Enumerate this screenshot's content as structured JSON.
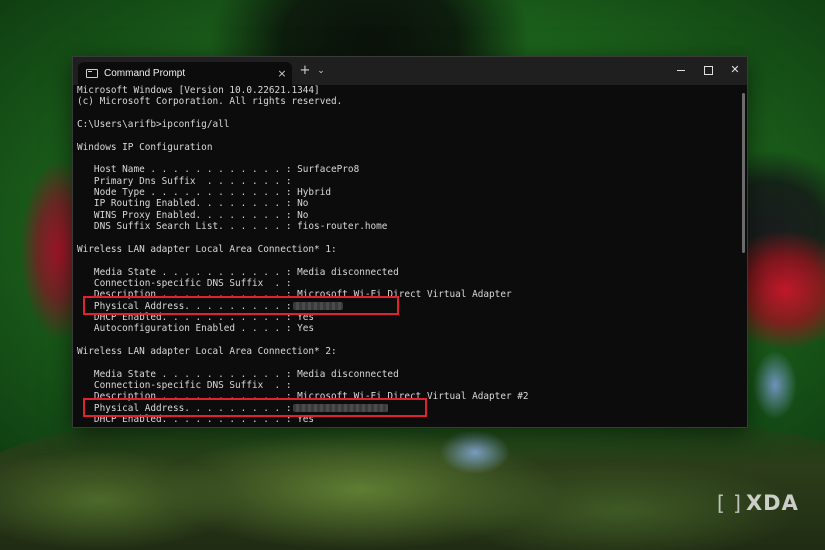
{
  "window": {
    "tab_title": "Command Prompt",
    "tab_close_icon": "×",
    "new_tab_icon": "+",
    "dropdown_icon": "⌄",
    "close_icon": "✕"
  },
  "console": {
    "lines": [
      "Microsoft Windows [Version 10.0.22621.1344]",
      "(c) Microsoft Corporation. All rights reserved.",
      "",
      "C:\\Users\\arifb>ipconfig/all",
      "",
      "Windows IP Configuration",
      "",
      "   Host Name . . . . . . . . . . . . : SurfacePro8",
      "   Primary Dns Suffix  . . . . . . . :",
      "   Node Type . . . . . . . . . . . . : Hybrid",
      "   IP Routing Enabled. . . . . . . . : No",
      "   WINS Proxy Enabled. . . . . . . . : No",
      "   DNS Suffix Search List. . . . . . : fios-router.home",
      "",
      "Wireless LAN adapter Local Area Connection* 1:",
      "",
      "   Media State . . . . . . . . . . . : Media disconnected",
      "   Connection-specific DNS Suffix  . :",
      "   Description . . . . . . . . . . . : Microsoft Wi-Fi Direct Virtual Adapter",
      "   Physical Address. . . . . . . . . :",
      "   DHCP Enabled. . . . . . . . . . . : Yes",
      "   Autoconfiguration Enabled . . . . : Yes",
      "",
      "Wireless LAN adapter Local Area Connection* 2:",
      "",
      "   Media State . . . . . . . . . . . : Media disconnected",
      "   Connection-specific DNS Suffix  . :",
      "   Description . . . . . . . . . . . : Microsoft Wi-Fi Direct Virtual Adapter #2",
      "   Physical Address. . . . . . . . . :",
      "   DHCP Enabled. . . . . . . . . . . : Yes"
    ],
    "redacted_line_indices": [
      19,
      28
    ],
    "highlighted_line_indices": [
      19,
      28
    ]
  },
  "colors": {
    "console_bg": "#0c0c0c",
    "console_text": "#d8d8d8",
    "highlight": "#e0212f"
  },
  "watermark": {
    "text": "XDA"
  }
}
